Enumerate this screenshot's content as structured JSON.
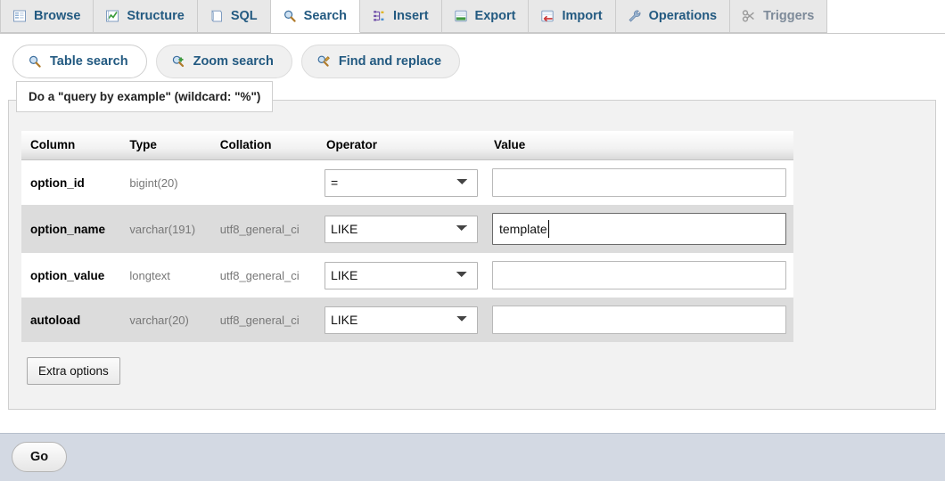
{
  "tabs": [
    {
      "label": "Browse",
      "icon": "browse-icon",
      "active": false,
      "dim": false
    },
    {
      "label": "Structure",
      "icon": "structure-icon",
      "active": false,
      "dim": false
    },
    {
      "label": "SQL",
      "icon": "sql-icon",
      "active": false,
      "dim": false
    },
    {
      "label": "Search",
      "icon": "search-icon",
      "active": true,
      "dim": false
    },
    {
      "label": "Insert",
      "icon": "insert-icon",
      "active": false,
      "dim": false
    },
    {
      "label": "Export",
      "icon": "export-icon",
      "active": false,
      "dim": false
    },
    {
      "label": "Import",
      "icon": "import-icon",
      "active": false,
      "dim": false
    },
    {
      "label": "Operations",
      "icon": "operations-icon",
      "active": false,
      "dim": false
    },
    {
      "label": "Triggers",
      "icon": "triggers-icon",
      "active": false,
      "dim": true
    }
  ],
  "subtabs": [
    {
      "label": "Table search",
      "icon": "magnifier-icon",
      "active": true
    },
    {
      "label": "Zoom search",
      "icon": "magnifier-plus-icon",
      "active": false
    },
    {
      "label": "Find and replace",
      "icon": "magnifier-wrench-icon",
      "active": false
    }
  ],
  "fieldset": {
    "legend": "Do a \"query by example\" (wildcard: \"%\")"
  },
  "table": {
    "headers": [
      "Column",
      "Type",
      "Collation",
      "Operator",
      "Value"
    ],
    "rows": [
      {
        "column": "option_id",
        "type": "bigint(20)",
        "collation": "",
        "operator": "=",
        "value": "",
        "focused": false
      },
      {
        "column": "option_name",
        "type": "varchar(191)",
        "collation": "utf8_general_ci",
        "operator": "LIKE",
        "value": "template",
        "focused": true
      },
      {
        "column": "option_value",
        "type": "longtext",
        "collation": "utf8_general_ci",
        "operator": "LIKE",
        "value": "",
        "focused": false
      },
      {
        "column": "autoload",
        "type": "varchar(20)",
        "collation": "utf8_general_ci",
        "operator": "LIKE",
        "value": "",
        "focused": false
      }
    ]
  },
  "buttons": {
    "extra_options": "Extra options",
    "go": "Go"
  },
  "colors": {
    "link": "#235a81",
    "footer_bg": "#d3d9e3",
    "row_even": "#dcdcdc",
    "fieldset_bg": "#f2f2f2"
  }
}
